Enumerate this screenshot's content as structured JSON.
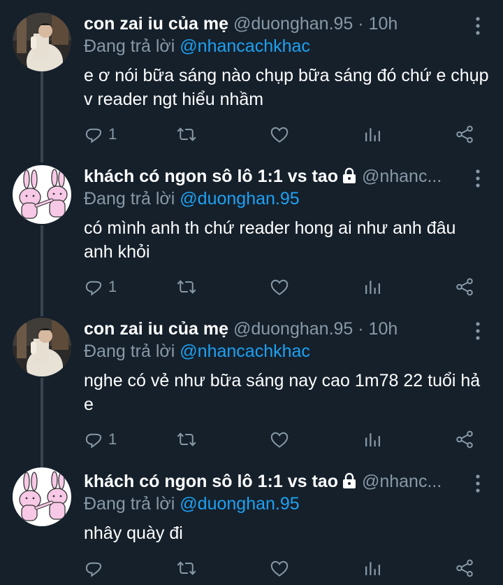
{
  "colors": {
    "background": "#15202b",
    "primary_text": "#ffffff",
    "secondary_text": "#8899a6",
    "accent": "#1da1f2",
    "thread_line": "#38444d"
  },
  "tweets": [
    {
      "display_name": "con zai iu của mẹ",
      "meta": "@duonghan.95 · 10h",
      "protected": false,
      "reply_label": "Đang trả lời",
      "reply_to": "@nhancachkhac",
      "text": "e ơ nói bữa sáng nào chụp bữa sáng đó chứ e chụp v reader ngt hiểu nhầm",
      "reply_count": "1",
      "avatar": "photo-person"
    },
    {
      "display_name": "khách có ngon sô lô 1:1 vs tao",
      "meta": "@nhanc...",
      "protected": true,
      "reply_label": "Đang trả lời",
      "reply_to": "@duonghan.95",
      "text": "có mình anh th chứ reader hong ai như anh đâu anh khỏi",
      "reply_count": "1",
      "avatar": "bunny-drawing"
    },
    {
      "display_name": "con zai iu của mẹ",
      "meta": "@duonghan.95 · 10h",
      "protected": false,
      "reply_label": "Đang trả lời",
      "reply_to": "@nhancachkhac",
      "text": "nghe có vẻ như bữa sáng nay cao 1m78 22 tuổi hả e",
      "reply_count": "1",
      "avatar": "photo-person"
    },
    {
      "display_name": "khách có ngon sô lô 1:1 vs tao",
      "meta": "@nhanc...",
      "protected": true,
      "reply_label": "Đang trả lời",
      "reply_to": "@duonghan.95",
      "text": "nhây quày đi",
      "reply_count": "",
      "avatar": "bunny-drawing"
    }
  ],
  "icons": [
    "reply-icon",
    "retweet-icon",
    "like-icon",
    "analytics-icon",
    "share-icon",
    "more-icon",
    "lock-icon"
  ]
}
